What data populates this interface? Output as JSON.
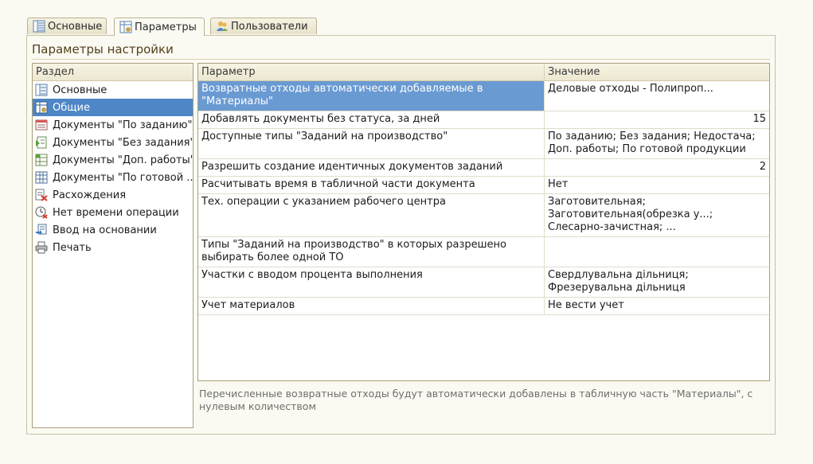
{
  "tabs": [
    {
      "label": "Основные",
      "icon": "list-icon"
    },
    {
      "label": "Параметры",
      "icon": "settings-table-icon"
    },
    {
      "label": "Пользователи",
      "icon": "users-icon"
    }
  ],
  "panel": {
    "title": "Параметры настройки"
  },
  "sections": {
    "header": "Раздел",
    "items": [
      {
        "label": "Основные",
        "icon": "list-icon"
      },
      {
        "label": "Общие",
        "icon": "settings-table-icon"
      },
      {
        "label": "Документы \"По заданию\"",
        "icon": "document-red-icon"
      },
      {
        "label": "Документы \"Без задания\"",
        "icon": "document-green-icon"
      },
      {
        "label": "Документы \"Доп. работы\"",
        "icon": "document-grid-icon"
      },
      {
        "label": "Документы \"По готовой ...",
        "icon": "document-blue-icon"
      },
      {
        "label": "Расхождения",
        "icon": "discrepancy-icon"
      },
      {
        "label": "Нет времени операции",
        "icon": "clock-icon"
      },
      {
        "label": "Ввод на основании",
        "icon": "input-based-icon"
      },
      {
        "label": "Печать",
        "icon": "printer-icon"
      }
    ]
  },
  "grid": {
    "columns": [
      "Параметр",
      "Значение"
    ],
    "rows": [
      {
        "param": "Возвратные отходы автоматически добавляемые в \"Материалы\"",
        "value": "Деловые отходы - Полипроп..."
      },
      {
        "param": "Добавлять документы без статуса, за дней",
        "value": "15"
      },
      {
        "param": "Доступные типы \"Заданий на производство\"",
        "value": "По заданию; Без задания; Недостача; Доп. работы; По готовой продукции"
      },
      {
        "param": "Разрешить создание идентичных документов заданий",
        "value": "2"
      },
      {
        "param": "Расчитывать время в табличной части документа",
        "value": "Нет"
      },
      {
        "param": "Тех. операции с указанием рабочего центра",
        "value": "Заготовительная; Заготовительная(обрезка у...; Слесарно-зачистная; ..."
      },
      {
        "param": "Типы \"Заданий на производство\" в которых разрешено выбирать более одной ТО",
        "value": ""
      },
      {
        "param": "Участки с вводом процента выполнения",
        "value": "Свердлувальна дільниця; Фрезерувальна дільниця"
      },
      {
        "param": "Учет материалов",
        "value": "Не вести учет"
      }
    ]
  },
  "hint": "Перечисленные возвратные отходы будут автоматически добавлены в табличную часть \"Материалы\", с нулевым количеством"
}
